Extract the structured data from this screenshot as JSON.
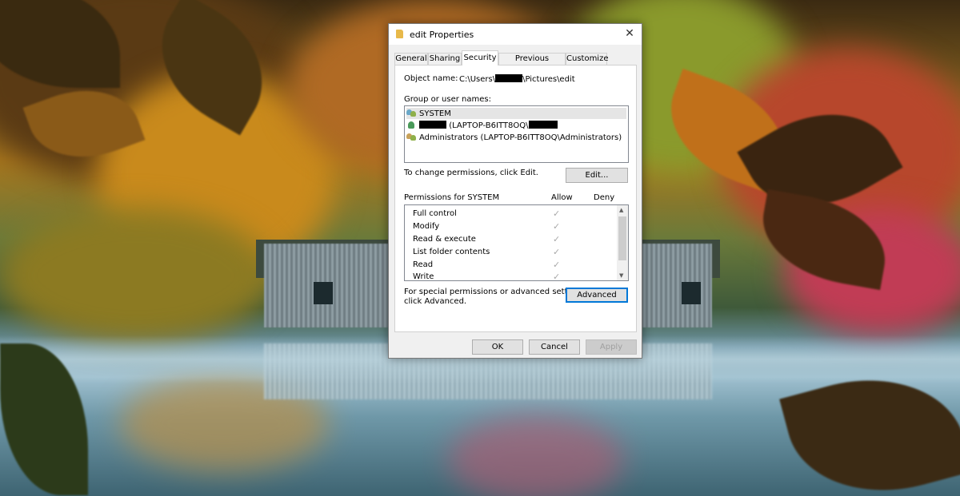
{
  "window": {
    "title": "edit Properties",
    "close_glyph": "✕"
  },
  "tabs": [
    {
      "label": "General",
      "active": false
    },
    {
      "label": "Sharing",
      "active": false
    },
    {
      "label": "Security",
      "active": true
    },
    {
      "label": "Previous Versions",
      "active": false
    },
    {
      "label": "Customize",
      "active": false
    }
  ],
  "security": {
    "object_name_label": "Object name:",
    "object_name_prefix": "C:\\Users\\",
    "object_name_suffix": "\\Pictures\\edit",
    "group_label": "Group or user names:",
    "users": [
      {
        "text": "SYSTEM",
        "selected": true
      },
      {
        "text": "(LAPTOP-B6ITT8OQ\\",
        "selected": false
      },
      {
        "text": "Administrators (LAPTOP-B6ITT8OQ\\Administrators)",
        "selected": false
      }
    ],
    "change_hint": "To change permissions, click Edit.",
    "edit_button": "Edit...",
    "permissions_label": "Permissions for SYSTEM",
    "allow_header": "Allow",
    "deny_header": "Deny",
    "permissions": [
      {
        "name": "Full control",
        "allow": true,
        "deny": false
      },
      {
        "name": "Modify",
        "allow": true,
        "deny": false
      },
      {
        "name": "Read & execute",
        "allow": true,
        "deny": false
      },
      {
        "name": "List folder contents",
        "allow": true,
        "deny": false
      },
      {
        "name": "Read",
        "allow": true,
        "deny": false
      },
      {
        "name": "Write",
        "allow": true,
        "deny": false
      }
    ],
    "check_glyph": "✓",
    "advanced_hint_line1": "For special permissions or advanced settings,",
    "advanced_hint_line2": "click Advanced.",
    "advanced_button": "Advanced"
  },
  "footer": {
    "ok": "OK",
    "cancel": "Cancel",
    "apply": "Apply"
  },
  "colors": {
    "accent": "#0078d7",
    "selection": "#e5e5e5",
    "dialog_bg": "#f0f0f0"
  }
}
